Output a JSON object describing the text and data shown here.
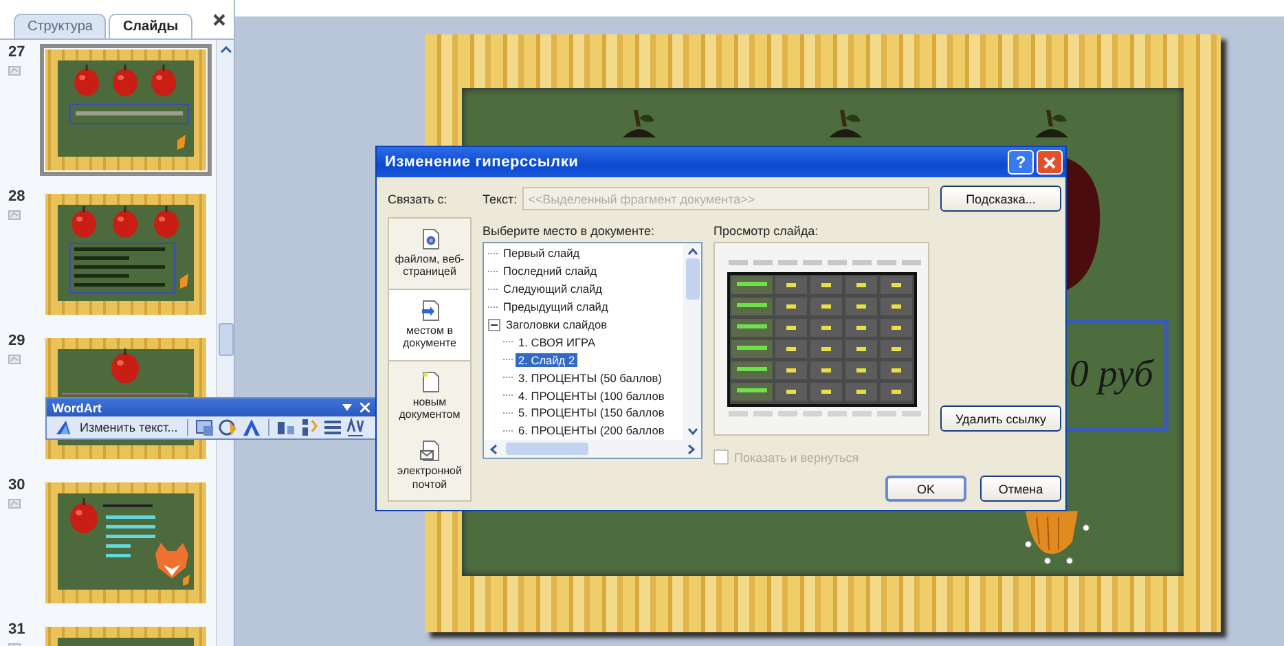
{
  "slides_pane": {
    "tabs": [
      {
        "label": "Структура",
        "selected": false
      },
      {
        "label": "Слайды",
        "selected": true
      }
    ],
    "slides": [
      {
        "number": "27",
        "kind": "apples-formula",
        "selected": true
      },
      {
        "number": "28",
        "kind": "apples-text",
        "selected": false
      },
      {
        "number": "29",
        "kind": "one-apple",
        "selected": false
      },
      {
        "number": "30",
        "kind": "apple-fox",
        "selected": false
      },
      {
        "number": "31",
        "kind": "blank",
        "selected": false
      }
    ]
  },
  "slide": {
    "caption": "0 руб"
  },
  "wordart_toolbar": {
    "title": "WordArt",
    "edit_button": "Изменить текст..."
  },
  "dialog": {
    "title": "Изменение гиперссылки",
    "help_button": "?",
    "link_to_label": "Связать с:",
    "text_label": "Текст:",
    "text_placeholder": "<<Выделенный фрагмент документа>>",
    "tooltip_button": "Подсказка...",
    "link_targets": [
      {
        "label": "файлом, веб-страницей",
        "kind": "file",
        "selected": false
      },
      {
        "label": "местом в документе",
        "kind": "place",
        "selected": true
      },
      {
        "label": "новым документом",
        "kind": "new",
        "selected": false
      },
      {
        "label": "электронной почтой",
        "kind": "email",
        "selected": false
      }
    ],
    "place_label": "Выберите место в документе:",
    "tree": [
      {
        "label": "Первый слайд",
        "selected": false
      },
      {
        "label": "Последний слайд",
        "selected": false
      },
      {
        "label": "Следующий слайд",
        "selected": false
      },
      {
        "label": "Предыдущий слайд",
        "selected": false
      },
      {
        "label": "Заголовки слайдов",
        "selected": false,
        "expanded": true,
        "children": [
          {
            "label": "1. СВОЯ ИГРА",
            "selected": false
          },
          {
            "label": "2. Слайд 2",
            "selected": true
          },
          {
            "label": "3. ПРОЦЕНТЫ (50 баллов)",
            "selected": false
          },
          {
            "label": "4. ПРОЦЕНТЫ (100 баллов",
            "selected": false
          },
          {
            "label": "5. ПРОЦЕНТЫ (150 баллов",
            "selected": false
          },
          {
            "label": "6. ПРОЦЕНТЫ (200 баллов",
            "selected": false
          }
        ]
      }
    ],
    "preview_label": "Просмотр слайда:",
    "show_and_return": {
      "label": "Показать и вернуться",
      "checked": false,
      "disabled": true
    },
    "remove_link_button": "Удалить ссылку",
    "ok_button": "OK",
    "cancel_button": "Отмена"
  }
}
